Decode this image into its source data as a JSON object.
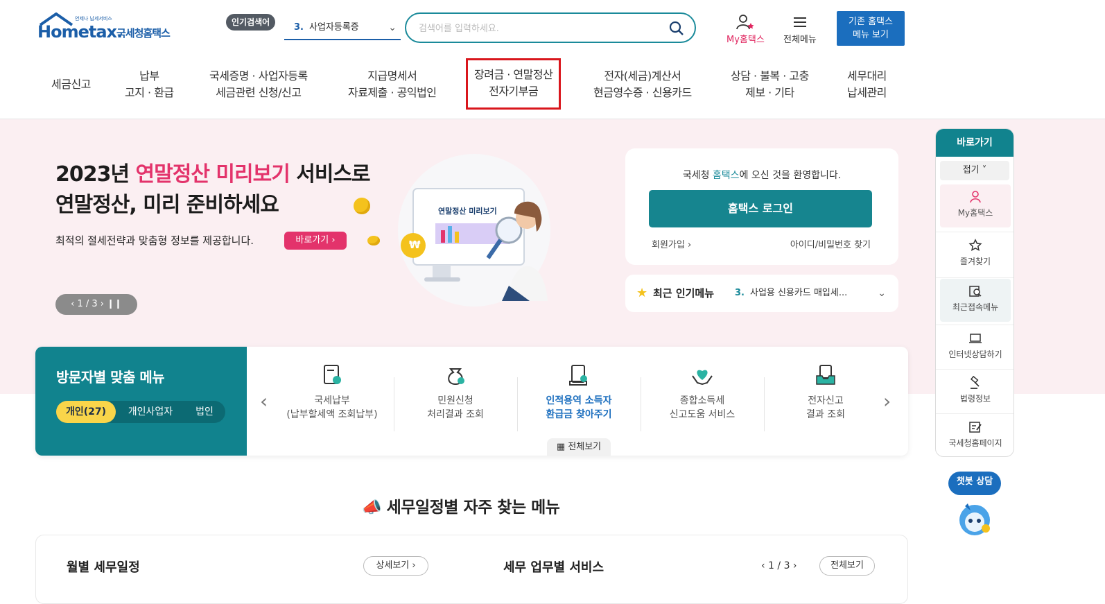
{
  "header": {
    "logo_sub": "언제나 납세서비스",
    "logo_word": "Hometax.",
    "logo_kr": "국세청홈택스",
    "popular_badge": "인기검색어",
    "popular_rank": "3.",
    "popular_term": "사업자등록증",
    "search_placeholder": "검색어를 입력하세요.",
    "my_label": "My홈택스",
    "all_menu_label": "전체메뉴",
    "old_menu_line1": "기존 홈택스",
    "old_menu_line2": "메뉴 보기"
  },
  "gnb": [
    {
      "line1": "세금신고",
      "line2": ""
    },
    {
      "line1": "납부",
      "line2": "고지 · 환급"
    },
    {
      "line1": "국세증명 · 사업자등록",
      "line2": "세금관련 신청/신고"
    },
    {
      "line1": "지급명세서",
      "line2": "자료제출 · 공익법인"
    },
    {
      "line1": "장려금 · 연말정산",
      "line2": "전자기부금"
    },
    {
      "line1": "전자(세금)계산서",
      "line2": "현금영수증 · 신용카드"
    },
    {
      "line1": "상담 · 불복 · 고충",
      "line2": "제보 · 기타"
    },
    {
      "line1": "세무대리",
      "line2": "납세관리"
    }
  ],
  "hero": {
    "title_part1": "2023년 ",
    "title_pink": "연말정산 미리보기",
    "title_part2": " 서비스로",
    "title_line2": "연말정산, 미리 준비하세요",
    "subtitle": "최적의 절세전략과 맞춤형 정보를 제공합니다.",
    "go_button": "바로가기 ›",
    "pager": "‹  1 / 3  ›   ❙❙",
    "illus_label": "연말정산 미리보기",
    "coin_symbol": "₩"
  },
  "login": {
    "welcome_pre": "국세청 ",
    "welcome_teal": "홈택스",
    "welcome_post": "에 오신 것을 환영합니다.",
    "login_button": "홈택스 로그인",
    "join": "회원가입 ›",
    "find": "아이디/비밀번호 찾기"
  },
  "recent": {
    "label": "최근 인기메뉴",
    "rank": "3.",
    "value": "사업용 신용카드 매입세..."
  },
  "visitor": {
    "title": "방문자별 맞춤 메뉴",
    "tabs": [
      "개인(27)",
      "개인사업자",
      "법인"
    ],
    "services": [
      {
        "line1": "국세납부",
        "line2": "(납부할세액 조회납부)"
      },
      {
        "line1": "민원신청",
        "line2": "처리결과 조회"
      },
      {
        "line1": "인적용역 소득자",
        "line2": "환급금 찾아주기"
      },
      {
        "line1": "종합소득세",
        "line2": "신고도움 서비스"
      },
      {
        "line1": "전자신고",
        "line2": "결과 조회"
      }
    ],
    "all_view": "전체보기"
  },
  "schedule": {
    "title": "세무일정별 자주 찾는 메뉴",
    "monthly": "월별 세무일정",
    "detail": "상세보기 ›",
    "by_task": "세무 업무별 서비스",
    "page": "‹  1 / 3  ›",
    "all": "전체보기"
  },
  "quick": {
    "title": "바로가기",
    "fold": "접기 ˅",
    "items": [
      "My홈택스",
      "즐겨찾기",
      "최근접속메뉴",
      "인터넷상담하기",
      "법령정보",
      "국세청홈페이지"
    ]
  },
  "chatbot": "챗봇 상담",
  "colors": {
    "teal": "#11838e",
    "pink": "#e3336b",
    "blue": "#1b6ebe",
    "highlight": "#d9161c"
  }
}
